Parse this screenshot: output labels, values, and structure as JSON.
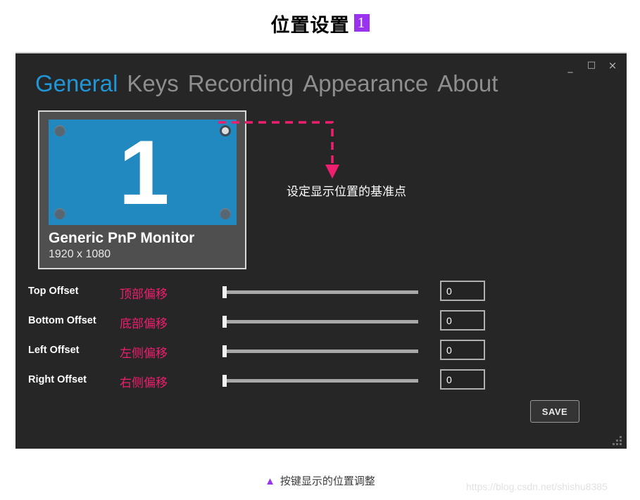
{
  "page": {
    "heading_text": "位置设置",
    "heading_badge": "1",
    "caption_marker": "▲",
    "caption_text": "按键显示的位置调整",
    "watermark": "https://blog.csdn.net/shishu8385",
    "accent_purple": "#9933ee",
    "accent_pink": "#ee1f6e",
    "accent_blue": "#2196d6"
  },
  "window": {
    "background": "#262626",
    "controls": {
      "minimize": "_",
      "maximize": "□",
      "close": "×"
    },
    "tabs": [
      {
        "label": "General",
        "active": true
      },
      {
        "label": "Keys",
        "active": false
      },
      {
        "label": "Recording",
        "active": false
      },
      {
        "label": "Appearance",
        "active": false
      },
      {
        "label": "About",
        "active": false
      }
    ]
  },
  "monitor": {
    "number": "1",
    "name": "Generic PnP Monitor",
    "resolution": "1920 x 1080",
    "screen_color": "#2189c0",
    "anchors": [
      {
        "position": "top-left",
        "selected": false
      },
      {
        "position": "top-right",
        "selected": true
      },
      {
        "position": "bottom-left",
        "selected": false
      },
      {
        "position": "bottom-right",
        "selected": false
      }
    ]
  },
  "annotation": {
    "text": "设定显示位置的基准点",
    "color": "#ee1f6e"
  },
  "offsets": [
    {
      "label_en": "Top Offset",
      "label_cn": "顶部偏移",
      "value": "0",
      "slider_percent": 0
    },
    {
      "label_en": "Bottom Offset",
      "label_cn": "底部偏移",
      "value": "0",
      "slider_percent": 0
    },
    {
      "label_en": "Left Offset",
      "label_cn": "左侧偏移",
      "value": "0",
      "slider_percent": 0
    },
    {
      "label_en": "Right Offset",
      "label_cn": "右侧偏移",
      "value": "0",
      "slider_percent": 0
    }
  ],
  "actions": {
    "save_label": "SAVE"
  }
}
